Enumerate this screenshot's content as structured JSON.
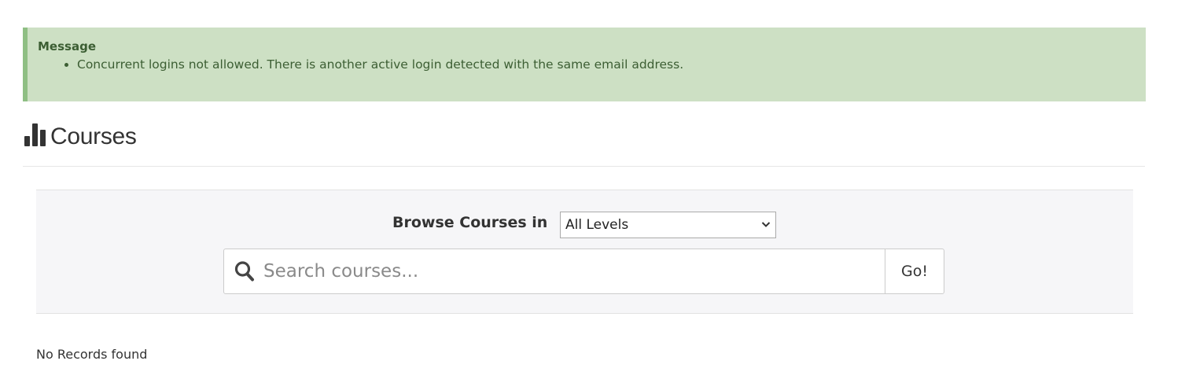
{
  "alert": {
    "title": "Message",
    "messages": [
      "Concurrent logins not allowed. There is another active login detected with the same email address."
    ],
    "bg_color": "#cde0c4",
    "border_color": "#8fbf84",
    "text_color": "#3c5e33"
  },
  "header": {
    "icon": "bar-chart-icon",
    "title": "Courses"
  },
  "browse": {
    "label": "Browse Courses in",
    "level_select": {
      "selected": "All Levels"
    },
    "search": {
      "placeholder": "Search courses...",
      "value": "",
      "icon": "search-icon",
      "button_label": "Go!"
    }
  },
  "results": {
    "empty_message": "No Records found"
  }
}
